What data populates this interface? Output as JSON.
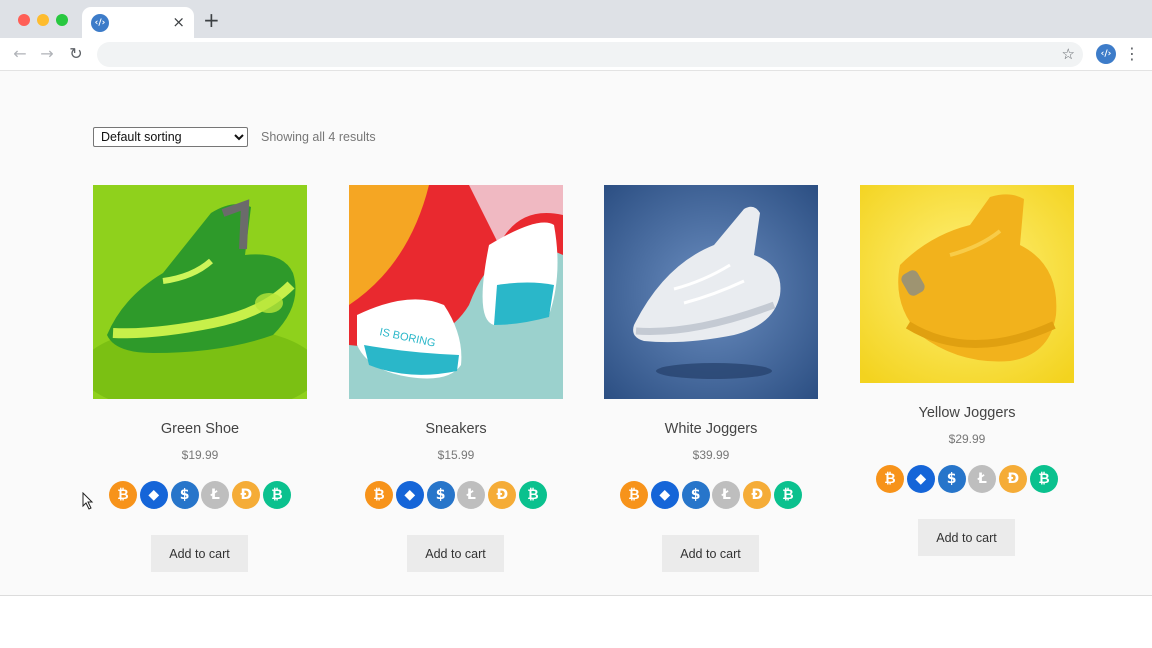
{
  "browser": {
    "tab_favicon": "codepen-style-logo",
    "tab_close": "×",
    "new_tab": "+",
    "back": "←",
    "forward": "→",
    "reload": "↻",
    "bookmark_star": "☆",
    "menu": "⋮"
  },
  "shop": {
    "sorting_selected": "Default sorting",
    "results_text": "Showing all 4 results"
  },
  "products": [
    {
      "name": "Green Shoe",
      "price": "$19.99",
      "button": "Add to cart"
    },
    {
      "name": "Sneakers",
      "price": "$15.99",
      "button": "Add to cart"
    },
    {
      "name": "White Joggers",
      "price": "$39.99",
      "button": "Add to cart"
    },
    {
      "name": "Yellow Joggers",
      "price": "$29.99",
      "button": "Add to cart"
    }
  ],
  "coins": [
    {
      "icon": "bitcoin-icon",
      "glyph": "₿",
      "color": "#f7931a"
    },
    {
      "icon": "ethereum-icon",
      "glyph": "◆",
      "color": "#1565d8"
    },
    {
      "icon": "usd-coin-icon",
      "glyph": "$",
      "color": "#2775ca"
    },
    {
      "icon": "litecoin-icon",
      "glyph": "Ł",
      "color": "#bebebe"
    },
    {
      "icon": "dai-icon",
      "glyph": "Đ",
      "color": "#f5ac37"
    },
    {
      "icon": "bitcoin-cash-icon",
      "glyph": "₿",
      "color": "#0ac18e"
    }
  ]
}
